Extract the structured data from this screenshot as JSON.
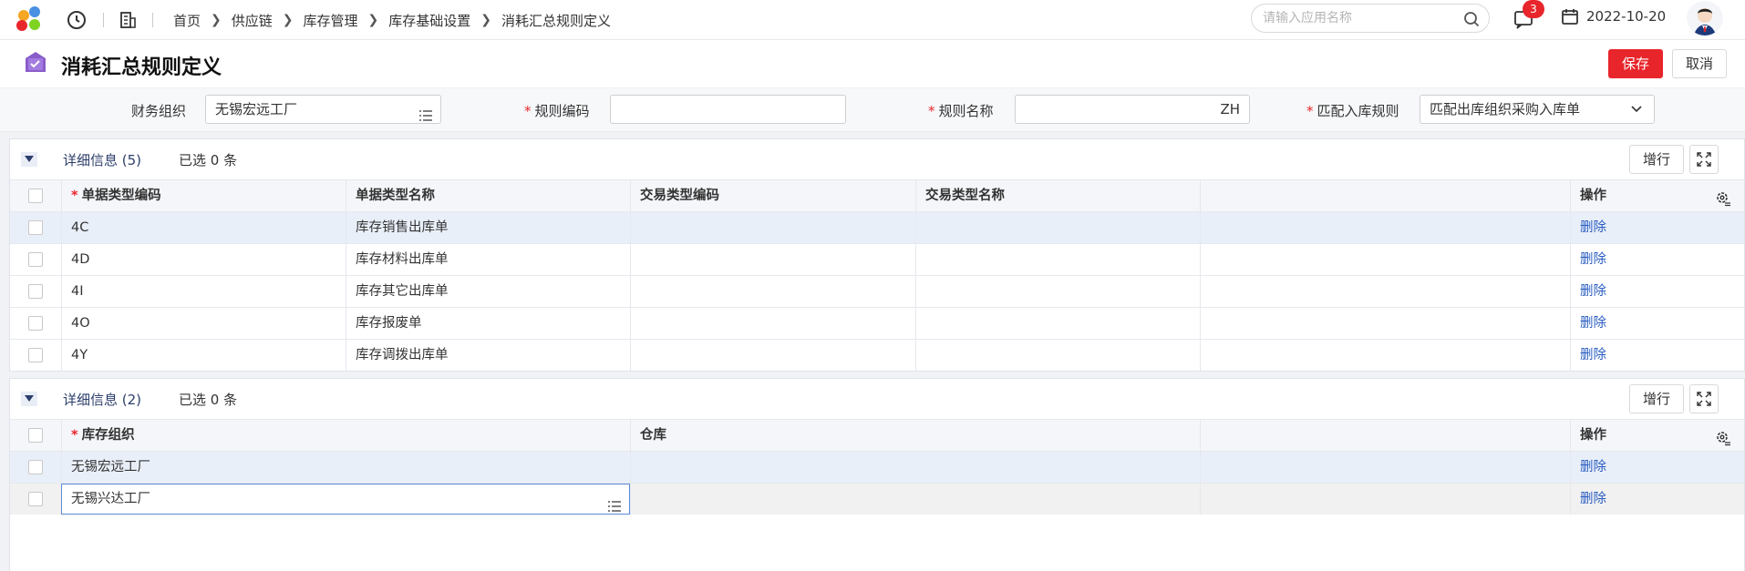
{
  "topbar": {
    "breadcrumbs": [
      "首页",
      "供应链",
      "库存管理",
      "库存基础设置",
      "消耗汇总规则定义"
    ],
    "search_placeholder": "请输入应用名称",
    "message_count": "3",
    "date": "2022-10-20"
  },
  "header": {
    "title": "消耗汇总规则定义",
    "save_label": "保存",
    "cancel_label": "取消"
  },
  "form": {
    "finance_org_label": "财务组织",
    "finance_org_value": "无锡宏远工厂",
    "rule_code_label": "规则编码",
    "rule_code_value": "",
    "rule_name_label": "规则名称",
    "rule_name_value": "ZH",
    "match_rule_label": "匹配入库规则",
    "match_rule_value": "匹配出库组织采购入库单"
  },
  "panel1": {
    "title": "详细信息 (5)",
    "selected": "已选 0 条",
    "add_row_label": "增行",
    "columns": [
      "单据类型编码",
      "单据类型名称",
      "交易类型编码",
      "交易类型名称",
      "",
      "操作"
    ],
    "rows": [
      {
        "code": "4C",
        "name": "库存销售出库单",
        "tcode": "",
        "tname": "",
        "action": "删除"
      },
      {
        "code": "4D",
        "name": "库存材料出库单",
        "tcode": "",
        "tname": "",
        "action": "删除"
      },
      {
        "code": "4I",
        "name": "库存其它出库单",
        "tcode": "",
        "tname": "",
        "action": "删除"
      },
      {
        "code": "4O",
        "name": "库存报废单",
        "tcode": "",
        "tname": "",
        "action": "删除"
      },
      {
        "code": "4Y",
        "name": "库存调拨出库单",
        "tcode": "",
        "tname": "",
        "action": "删除"
      }
    ]
  },
  "panel2": {
    "title": "详细信息 (2)",
    "selected": "已选 0 条",
    "add_row_label": "增行",
    "columns": [
      "库存组织",
      "仓库",
      "",
      "操作"
    ],
    "rows": [
      {
        "org": "无锡宏远工厂",
        "warehouse": "",
        "action": "删除"
      },
      {
        "org": "无锡兴达工厂",
        "warehouse": "",
        "action": "删除"
      }
    ]
  },
  "colors": {
    "brand_red": "#e8252b",
    "link_blue": "#2a5dc1"
  }
}
